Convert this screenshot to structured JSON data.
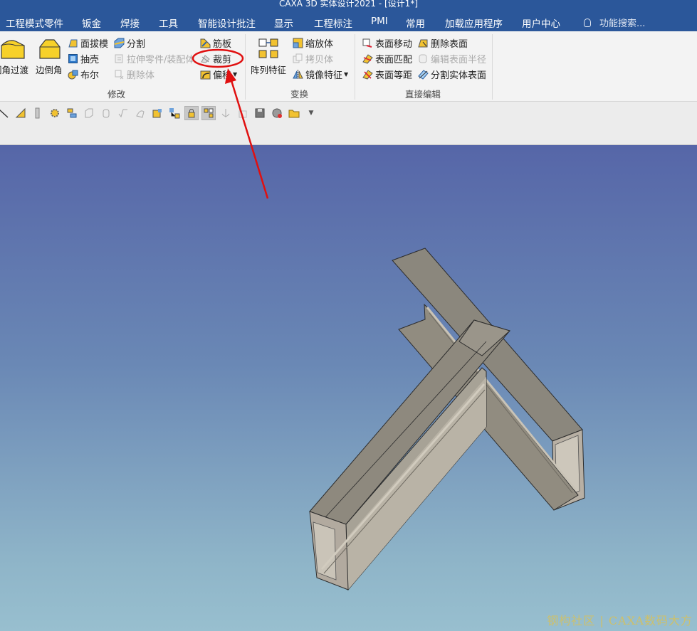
{
  "window": {
    "title": "CAXA 3D 实体设计2021 - [设计1*]"
  },
  "menu": {
    "items": [
      "工程模式零件",
      "钣金",
      "焊接",
      "工具",
      "智能设计批注",
      "显示",
      "工程标注",
      "PMI",
      "常用",
      "加载应用程序",
      "用户中心"
    ],
    "search_placeholder": "功能搜索..."
  },
  "ribbon": {
    "modify": {
      "label": "修改",
      "big": [
        "圆角过渡",
        "边倒角"
      ],
      "col1": [
        "面拔模",
        "抽壳",
        "布尔"
      ],
      "col2": [
        "分割",
        "拉伸零件/装配体",
        "删除体"
      ],
      "col3": [
        "筋板",
        "裁剪",
        "偏移"
      ]
    },
    "transform": {
      "label": "变换",
      "big": "阵列特征",
      "col": [
        "缩放体",
        "拷贝体",
        "镜像特征"
      ]
    },
    "direct_edit": {
      "label": "直接编辑",
      "col1": [
        "表面移动",
        "表面匹配",
        "表面等距"
      ],
      "col2": [
        "删除表面",
        "编辑表面半径",
        "分割实体表面"
      ]
    }
  },
  "watermark": "钢构社区 | CAXA数码大方",
  "colors": {
    "menubar": "#2b579a",
    "annotation": "#e01010",
    "model": "#8c877b"
  }
}
